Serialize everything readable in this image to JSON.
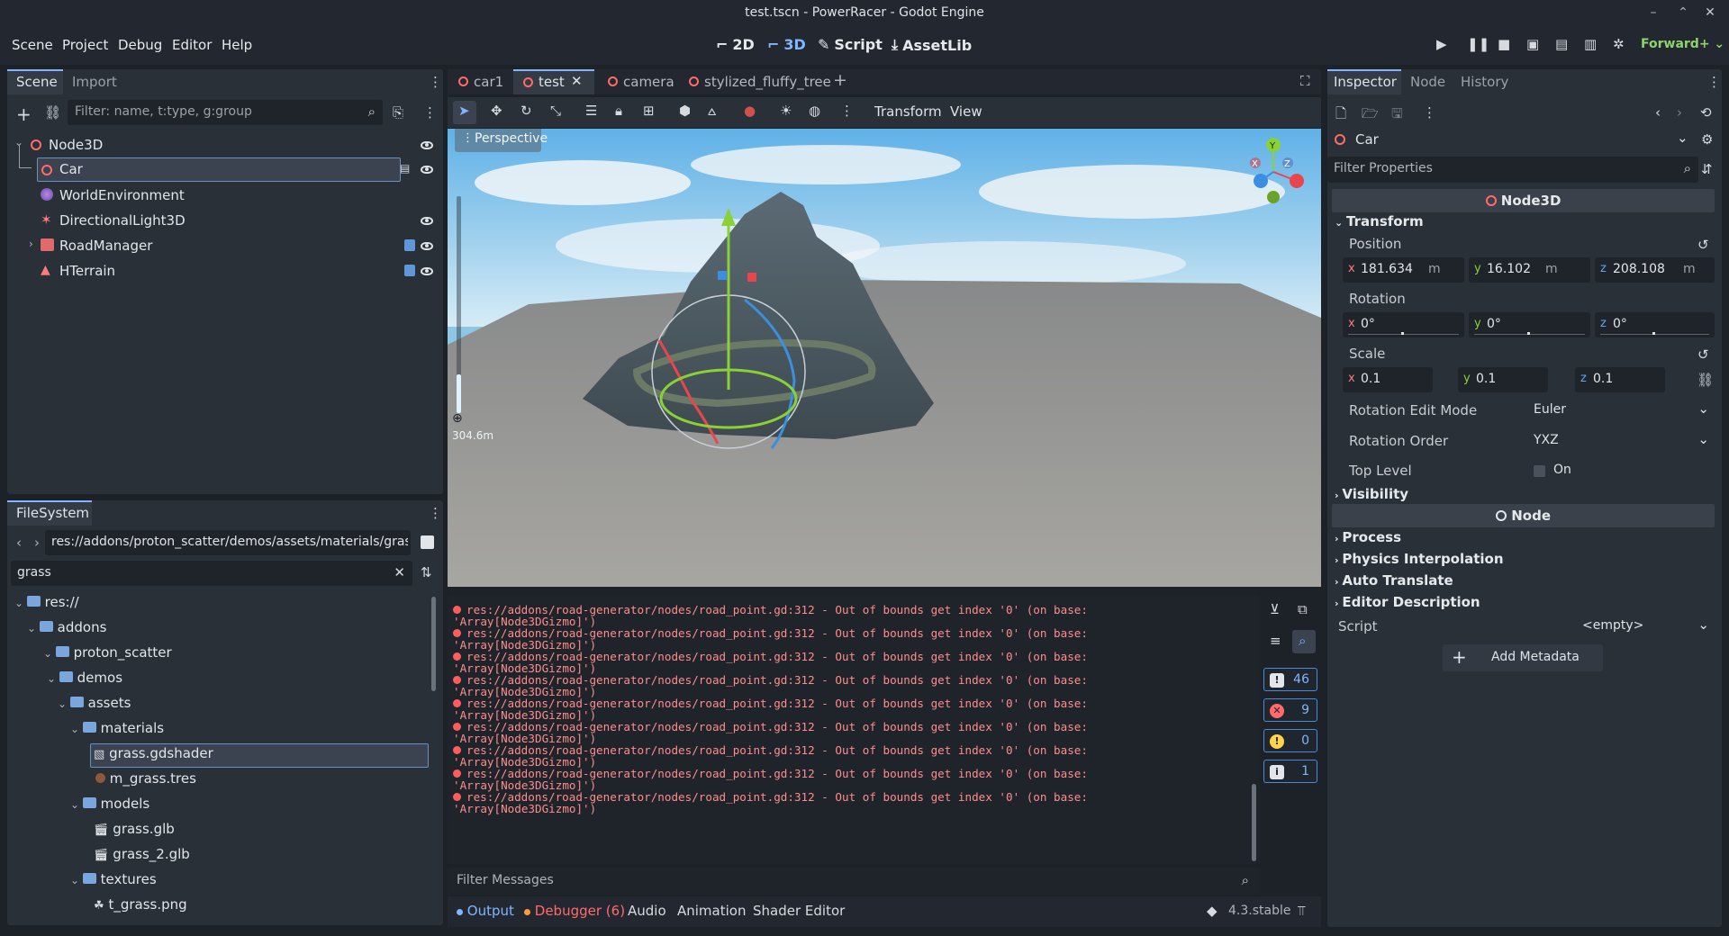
{
  "window": {
    "title": "test.tscn - PowerRacer - Godot Engine"
  },
  "menu": [
    "Scene",
    "Project",
    "Debug",
    "Editor",
    "Help"
  ],
  "workspaces": {
    "w2d": "2D",
    "w3d": "3D",
    "script": "Script",
    "assetlib": "AssetLib"
  },
  "renderer": "Forward+",
  "scene_dock": {
    "tab_scene": "Scene",
    "tab_import": "Import",
    "filter_placeholder": "Filter: name, t:type, g:group",
    "nodes": [
      "Node3D",
      "Car",
      "WorldEnvironment",
      "DirectionalLight3D",
      "RoadManager",
      "HTerrain"
    ]
  },
  "filesystem": {
    "tab": "FileSystem",
    "path": "res://addons/proton_scatter/demos/assets/materials/grass.",
    "search": "grass",
    "items": [
      "res://",
      "addons",
      "proton_scatter",
      "demos",
      "assets",
      "materials",
      "grass.gdshader",
      "m_grass.tres",
      "models",
      "grass.glb",
      "grass_2.glb",
      "textures",
      "t_grass.png"
    ]
  },
  "scene_tabs": [
    "car1",
    "test",
    "camera",
    "stylized_fluffy_tree"
  ],
  "viewport": {
    "toolbar_transform": "Transform",
    "toolbar_view": "View",
    "perspective": "Perspective",
    "scale_label": "304.6m",
    "gizmo_axes": [
      "Y",
      "Z",
      "X"
    ]
  },
  "output": {
    "lines": [
      [
        "res://addons/road-generator/nodes/road_point.gd:312 - Out of bounds get index '0' (on base:",
        "'Array[Node3DGizmo]')"
      ],
      [
        "res://addons/road-generator/nodes/road_point.gd:312 - Out of bounds get index '0' (on base:",
        "'Array[Node3DGizmo]')"
      ],
      [
        "res://addons/road-generator/nodes/road_point.gd:312 - Out of bounds get index '0' (on base:",
        "'Array[Node3DGizmo]')"
      ],
      [
        "res://addons/road-generator/nodes/road_point.gd:312 - Out of bounds get index '0' (on base:",
        "'Array[Node3DGizmo]')"
      ],
      [
        "res://addons/road-generator/nodes/road_point.gd:312 - Out of bounds get index '0' (on base:",
        "'Array[Node3DGizmo]')"
      ],
      [
        "res://addons/road-generator/nodes/road_point.gd:312 - Out of bounds get index '0' (on base:",
        "'Array[Node3DGizmo]')"
      ],
      [
        "res://addons/road-generator/nodes/road_point.gd:312 - Out of bounds get index '0' (on base:",
        "'Array[Node3DGizmo]')"
      ],
      [
        "res://addons/road-generator/nodes/road_point.gd:312 - Out of bounds get index '0' (on base:",
        "'Array[Node3DGizmo]')"
      ],
      [
        "res://addons/road-generator/nodes/road_point.gd:312 - Out of bounds get index '0' (on base:",
        "'Array[Node3DGizmo]')"
      ]
    ],
    "filter_placeholder": "Filter Messages",
    "counts": {
      "all": "46",
      "errors": "9",
      "warnings": "0",
      "info": "1"
    }
  },
  "bottom_tabs": {
    "output": "Output",
    "debugger": "Debugger (6)",
    "audio": "Audio",
    "animation": "Animation",
    "shader": "Shader Editor",
    "version": "4.3.stable"
  },
  "inspector": {
    "tabs": [
      "Inspector",
      "Node",
      "History"
    ],
    "object": "Car",
    "filter_placeholder": "Filter Properties",
    "class_node3d": "Node3D",
    "transform": "Transform",
    "position": "Position",
    "pos": {
      "x": "181.634",
      "y": "16.102",
      "z": "208.108",
      "unit": "m"
    },
    "rotation": "Rotation",
    "rot": {
      "x": "0",
      "y": "0",
      "z": "0",
      "unit": "°"
    },
    "scale": "Scale",
    "scl": {
      "x": "0.1",
      "y": "0.1",
      "z": "0.1"
    },
    "rotation_edit_mode": "Rotation Edit Mode",
    "rotation_edit_mode_val": "Euler",
    "rotation_order": "Rotation Order",
    "rotation_order_val": "YXZ",
    "top_level": "Top Level",
    "top_level_val": "On",
    "visibility": "Visibility",
    "class_node": "Node",
    "process": "Process",
    "physics": "Physics Interpolation",
    "auto_translate": "Auto Translate",
    "editor_desc": "Editor Description",
    "script": "Script",
    "script_val": "<empty>",
    "add_metadata": "Add Metadata"
  },
  "colors": {
    "accent": "#7fb6ff",
    "error": "#ff5d5d",
    "node3d": "#ff6b6b"
  }
}
